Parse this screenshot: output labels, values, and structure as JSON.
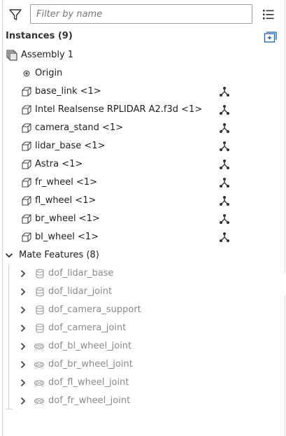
{
  "search": {
    "placeholder": "Filter by name",
    "value": ""
  },
  "instances": {
    "title": "Instances (9)",
    "assembly": "Assembly 1",
    "origin": "Origin",
    "parts": [
      "base_link <1>",
      "Intel Realsense RPLIDAR A2.f3d <1>",
      "camera_stand <1>",
      "lidar_base <1>",
      "Astra <1>",
      "fr_wheel <1>",
      "fl_wheel <1>",
      "br_wheel <1>",
      "bl_wheel <1>"
    ]
  },
  "mates": {
    "title": "Mate Features (8)",
    "items": [
      {
        "label": "dof_lidar_base",
        "icon": "fastened-mate-icon"
      },
      {
        "label": "dof_lidar_joint",
        "icon": "fastened-mate-icon"
      },
      {
        "label": "dof_camera_support",
        "icon": "fastened-mate-icon"
      },
      {
        "label": "dof_camera_joint",
        "icon": "fastened-mate-icon"
      },
      {
        "label": "dof_bl_wheel_joint",
        "icon": "revolute-mate-icon"
      },
      {
        "label": "dof_br_wheel_joint",
        "icon": "revolute-mate-icon"
      },
      {
        "label": "dof_fl_wheel_joint",
        "icon": "revolute-mate-icon"
      },
      {
        "label": "dof_fr_wheel_joint",
        "icon": "revolute-mate-icon"
      }
    ]
  },
  "colors": {
    "icon": "#333333",
    "mate_text": "#8a8a8a",
    "accent": "#1f5fb0"
  }
}
